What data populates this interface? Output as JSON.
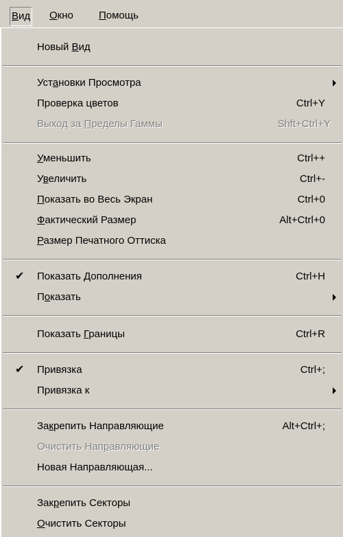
{
  "menubar": {
    "items": [
      {
        "pre": "",
        "u": "В",
        "post": "ид"
      },
      {
        "pre": "",
        "u": "О",
        "post": "кно"
      },
      {
        "pre": "",
        "u": "П",
        "post": "омощь"
      }
    ]
  },
  "menu": {
    "items": [
      {
        "pre": "Новый ",
        "u": "В",
        "post": "ид",
        "shortcut": ""
      },
      {
        "pre": "Уст",
        "u": "а",
        "post": "новки Просмотра",
        "shortcut": ""
      },
      {
        "pre": "Проверка цветов",
        "u": "",
        "post": "",
        "shortcut": "Ctrl+Y"
      },
      {
        "pre": "Выход за ",
        "u": "П",
        "post": "ределы Гаммы",
        "shortcut": "Shft+Ctrl+Y"
      },
      {
        "pre": "",
        "u": "У",
        "post": "меньшить",
        "shortcut": "Ctrl++"
      },
      {
        "pre": "У",
        "u": "в",
        "post": "еличить",
        "shortcut": "Ctrl+-"
      },
      {
        "pre": "",
        "u": "П",
        "post": "оказать во Весь Экран",
        "shortcut": "Ctrl+0"
      },
      {
        "pre": "",
        "u": "Ф",
        "post": "актический Размер",
        "shortcut": "Alt+Ctrl+0"
      },
      {
        "pre": "",
        "u": "Р",
        "post": "азмер Печатного Оттиска",
        "shortcut": ""
      },
      {
        "pre": "Показать ",
        "u": "Д",
        "post": "ополнения",
        "shortcut": "Ctrl+H"
      },
      {
        "pre": "П",
        "u": "о",
        "post": "казать",
        "shortcut": ""
      },
      {
        "pre": "Показать ",
        "u": "Г",
        "post": "раницы",
        "shortcut": "Ctrl+R"
      },
      {
        "pre": "Привязка",
        "u": "",
        "post": "",
        "shortcut": "Ctrl+;"
      },
      {
        "pre": "Привязка к",
        "u": "",
        "post": "",
        "shortcut": ""
      },
      {
        "pre": "За",
        "u": "к",
        "post": "репить Направляющие",
        "shortcut": "Alt+Ctrl+;"
      },
      {
        "pre": "Очистить Нап",
        "u": "р",
        "post": "авляющие",
        "shortcut": ""
      },
      {
        "pre": "Новая Направляющая...",
        "u": "",
        "post": "",
        "shortcut": ""
      },
      {
        "pre": "Зак",
        "u": "р",
        "post": "епить Секторы",
        "shortcut": ""
      },
      {
        "pre": "",
        "u": "О",
        "post": "чистить Секторы",
        "shortcut": ""
      }
    ],
    "check_glyph": "✔"
  }
}
